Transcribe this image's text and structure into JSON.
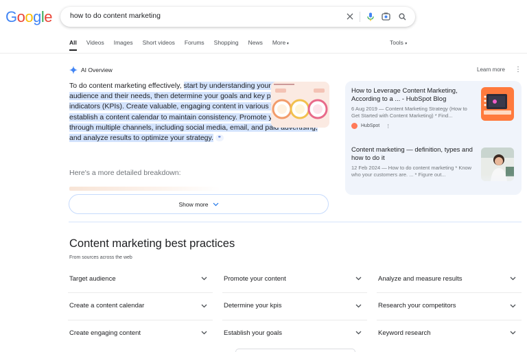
{
  "logo": {
    "text": [
      "G",
      "o",
      "o",
      "g",
      "l",
      "e"
    ],
    "colors": [
      "#4285F4",
      "#EA4335",
      "#FBBC05",
      "#4285F4",
      "#34A853",
      "#EA4335"
    ]
  },
  "search": {
    "query": "how to do content marketing"
  },
  "tabs": [
    "All",
    "Videos",
    "Images",
    "Short videos",
    "Forums",
    "Shopping",
    "News",
    "More"
  ],
  "tools_label": "Tools",
  "ai_overview": {
    "label": "AI Overview",
    "learn_more": "Learn more",
    "text_plain_1": "To do content marketing effectively, ",
    "text_hl": "start by understanding your target audience and their needs, then determine your goals and key performance indicators (KPIs). Create valuable, engaging content in various formats, and establish a content calendar to maintain consistency. Promote your content through multiple channels, including social media, email, and paid advertising, and analyze results to optimize your strategy.",
    "breakdown": "Here's a more detailed breakdown:",
    "show_more": "Show more"
  },
  "sources": [
    {
      "title": "How to Leverage Content Marketing, According to a ... - HubSpot Blog",
      "snippet": "6 Aug 2019 — Content Marketing Strategy (How to Get Started with Content Marketing) * Find...",
      "site": "HubSpot"
    },
    {
      "title": "Content marketing — definition, types and how to do it",
      "snippet": "12 Feb 2024 — How to do content marketing * Know who your customers are. ... * Figure out..."
    }
  ],
  "best_practices": {
    "title": "Content marketing best practices",
    "subtitle": "From sources across the web",
    "items": [
      "Target audience",
      "Promote your content",
      "Analyze and measure results",
      "Create a content calendar",
      "Determine your kpis",
      "Research your competitors",
      "Create engaging content",
      "Establish your goals",
      "Keyword research"
    ]
  },
  "colors": {
    "highlight": "#d3e3fd",
    "ai_blue": "#4285F4",
    "source_panel": "#f0f4fb"
  }
}
